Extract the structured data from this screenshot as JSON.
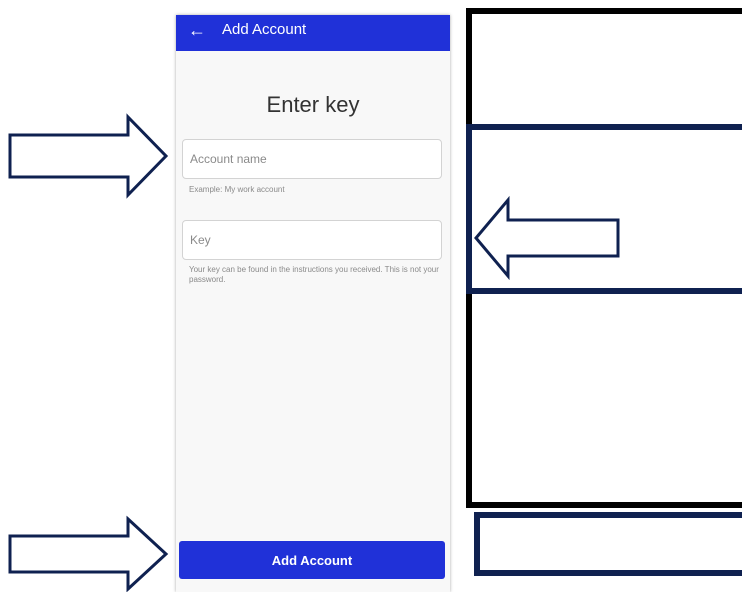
{
  "app_bar": {
    "back_icon": "←",
    "title": "Add Account",
    "color": "#2031d8"
  },
  "form": {
    "heading": "Enter key",
    "account_name": {
      "placeholder": "Account name",
      "value": "",
      "helper": "Example: My work account"
    },
    "key": {
      "placeholder": "Key",
      "value": "",
      "helper": "Your key can be found in the instructions you received. This is not your password."
    },
    "submit_label": "Add Account"
  },
  "annotations": {
    "arrow_color": "#0f2150",
    "frame_color_outer": "#000000",
    "frame_color_inner": "#0f2150",
    "arrow_icons": [
      "right-arrow-icon",
      "left-arrow-icon",
      "right-arrow-icon"
    ]
  }
}
